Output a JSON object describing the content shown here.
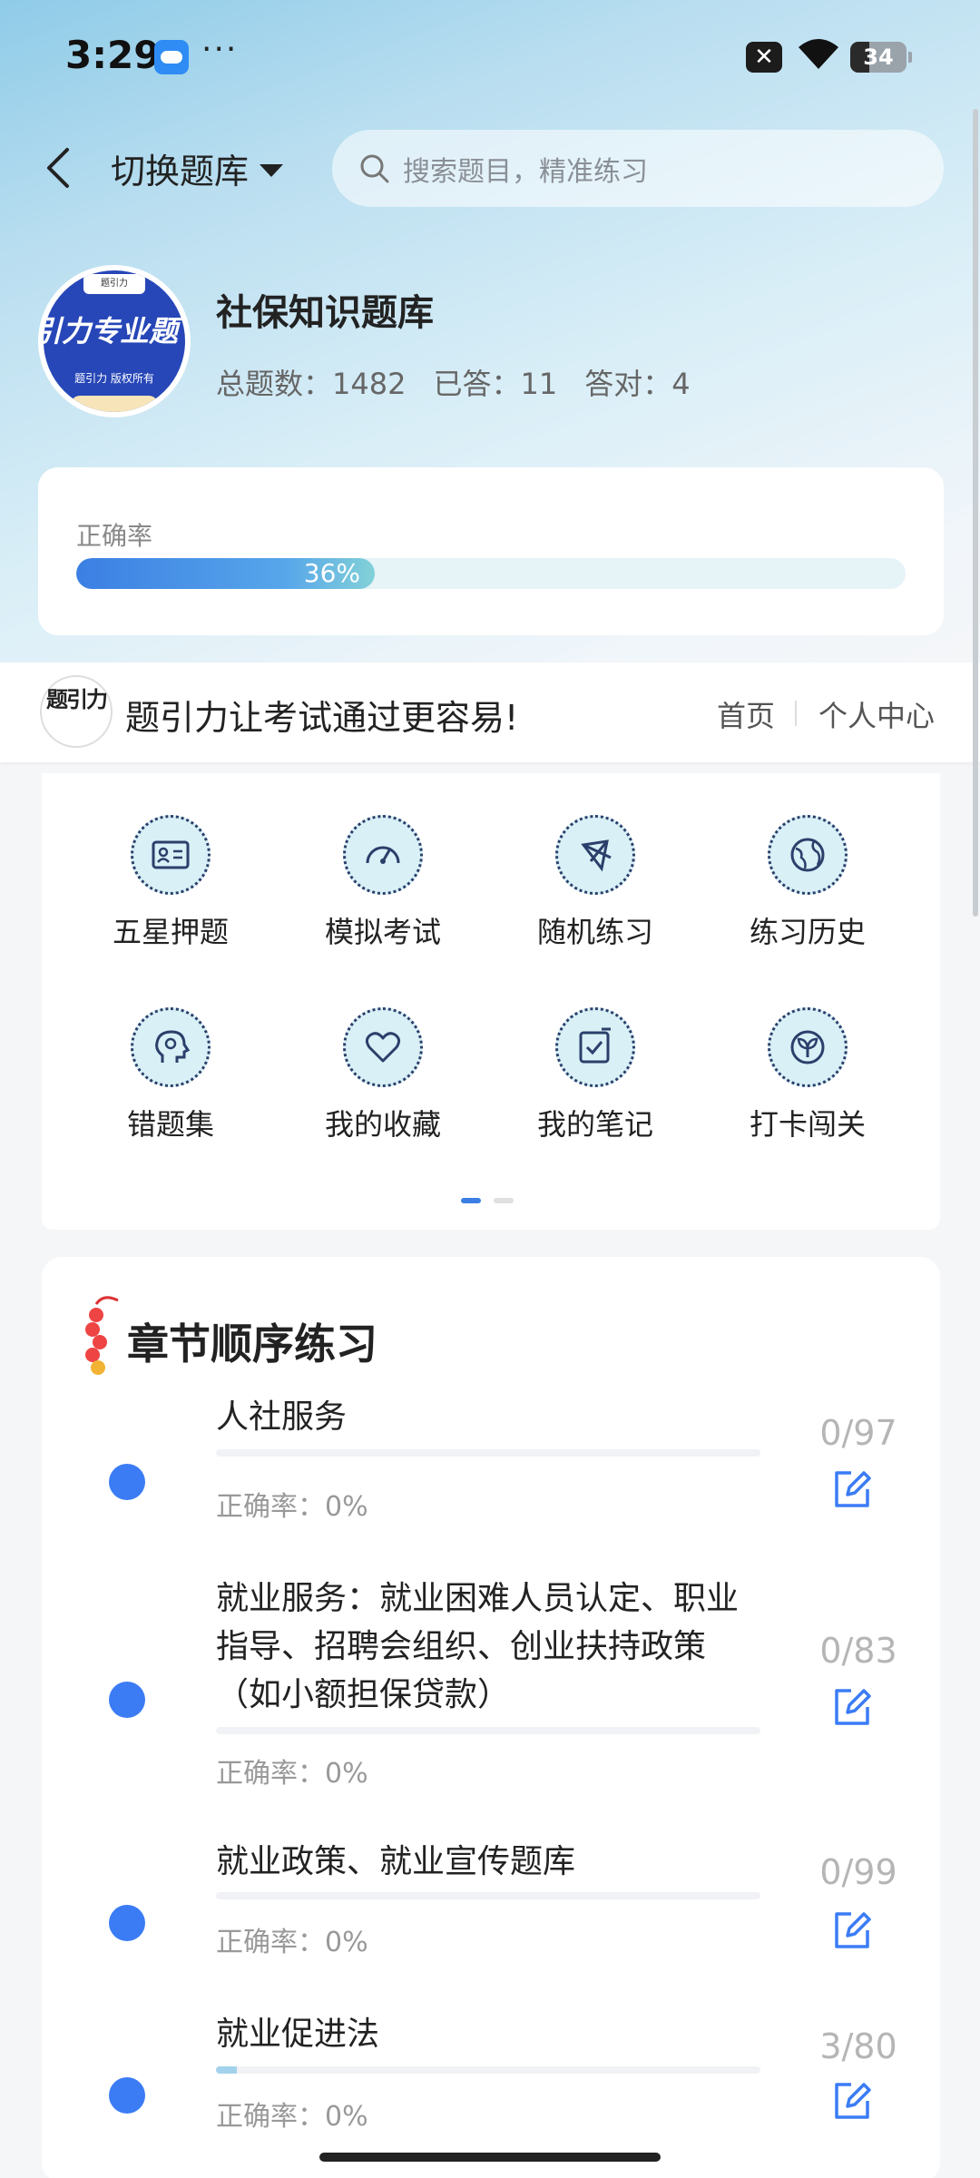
{
  "status_bar": {
    "time": "3:29",
    "more": "···",
    "battery": "34",
    "battery_level": 0.34
  },
  "header": {
    "switch_label": "切换题库",
    "search_placeholder": "搜索题目，精准练习"
  },
  "bank": {
    "logo_top": "题引力",
    "logo_title": "引力专业题",
    "logo_sub": "题引力 版权所有",
    "title": "社保知识题库",
    "total": "总题数：1482",
    "answered": "已答：11",
    "correct": "答对：4"
  },
  "accuracy": {
    "label": "正确率",
    "value_text": "36%",
    "value": 36
  },
  "brand": {
    "logo_text": "题引力",
    "slogan": "题引力让考试通过更容易!",
    "home": "首页",
    "center": "个人中心"
  },
  "functions": [
    {
      "label": "五星押题",
      "icon": "id-card-icon"
    },
    {
      "label": "模拟考试",
      "icon": "speedometer-icon"
    },
    {
      "label": "随机练习",
      "icon": "network-icon"
    },
    {
      "label": "练习历史",
      "icon": "globe-icon"
    },
    {
      "label": "错题集",
      "icon": "head-icon"
    },
    {
      "label": "我的收藏",
      "icon": "heart-icon"
    },
    {
      "label": "我的笔记",
      "icon": "note-check-icon"
    },
    {
      "label": "打卡闯关",
      "icon": "sprout-icon"
    }
  ],
  "chapters": {
    "heading": "章节顺序练习",
    "items": [
      {
        "title": "人社服务",
        "accuracy": "正确率：0%",
        "count": "0/97",
        "progress": 0
      },
      {
        "title": "就业服务：就业困难人员认定、职业指导、招聘会组织、创业扶持政策（如小额担保贷款）",
        "accuracy": "正确率：0%",
        "count": "0/83",
        "progress": 0
      },
      {
        "title": "就业政策、就业宣传题库",
        "accuracy": "正确率：0%",
        "count": "0/99",
        "progress": 0
      },
      {
        "title": "就业促进法",
        "accuracy": "正确率：0%",
        "count": "3/80",
        "progress": 0.0375
      }
    ]
  }
}
